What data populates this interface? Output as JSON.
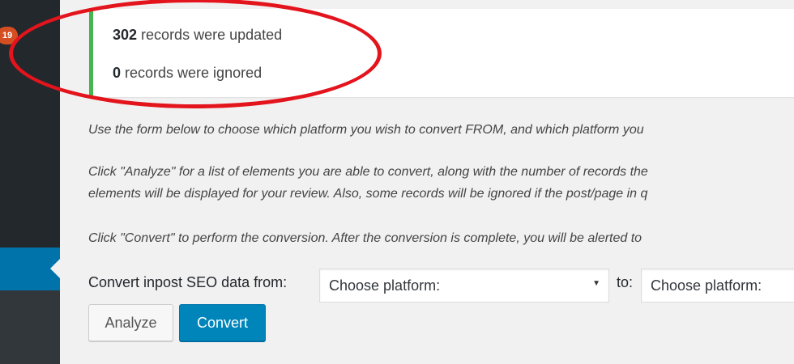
{
  "sidebar": {
    "badge": "19"
  },
  "notice": {
    "updated_count": "302",
    "updated_text": " records were updated",
    "ignored_count": "0",
    "ignored_text": " records were ignored"
  },
  "instructions": {
    "p1": "Use the form below to choose which platform you wish to convert FROM, and which platform you",
    "p2_line1": "Click \"Analyze\" for a list of elements you are able to convert, along with the number of records the",
    "p2_line2": "elements will be displayed for your review. Also, some records will be ignored if the post/page in q",
    "p3": "Click \"Convert\" to perform the conversion. After the conversion is complete, you will be alerted to"
  },
  "form": {
    "from_label": "Convert inpost SEO data from:",
    "from_select": "Choose platform:",
    "to_label": "to:",
    "to_select": "Choose platform:"
  },
  "buttons": {
    "analyze": "Analyze",
    "convert": "Convert"
  },
  "colors": {
    "sidebar": "#23282d",
    "active": "#0073aa",
    "notice_border": "#46b450",
    "annotation": "#e3141c",
    "primary_button": "#0085ba"
  }
}
